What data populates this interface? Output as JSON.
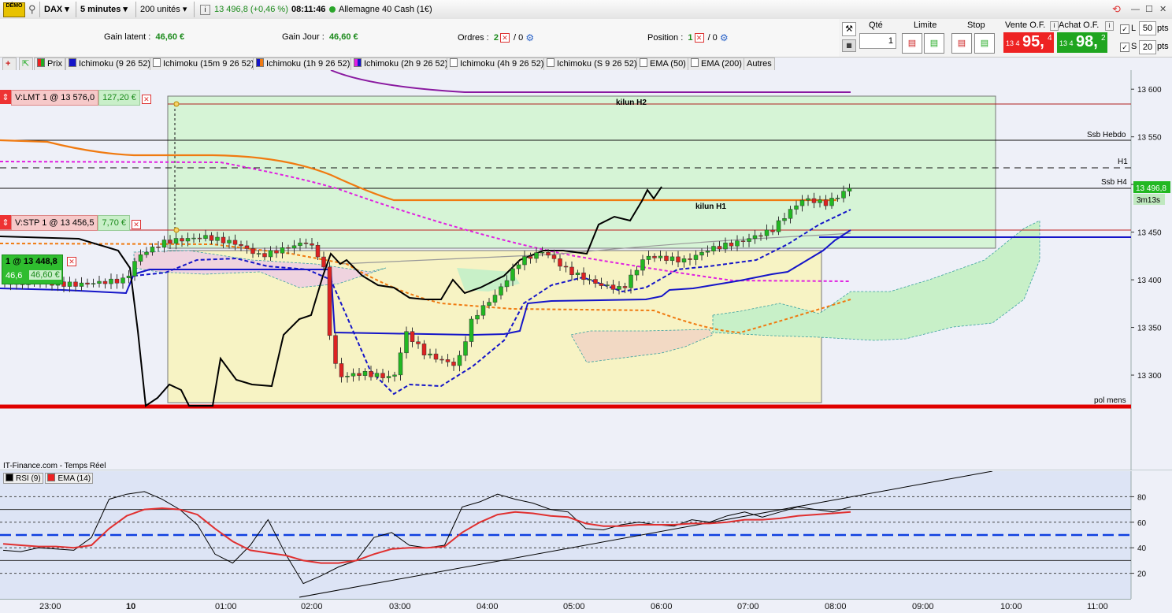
{
  "toolbar": {
    "instrument": "DAX",
    "timeframe": "5 minutes",
    "units": "200 unités",
    "quote": "13 496,8 (+0,46 %)",
    "time": "08:11:46",
    "market": "Allemagne 40 Cash (1€)",
    "demo": "DÉMO"
  },
  "account": {
    "gain_latent_label": "Gain latent :",
    "gain_latent": "46,60 €",
    "gain_jour_label": "Gain Jour :",
    "gain_jour": "46,60 €",
    "ordres_label": "Ordres :",
    "ordres_count": "2",
    "ordres_zero": "/ 0",
    "position_label": "Position :",
    "position_count": "1",
    "position_zero": "/ 0"
  },
  "order_panel": {
    "qty_label": "Qté",
    "qty_value": "1",
    "limit_label": "Limite",
    "stop_label": "Stop",
    "sell_label": "Vente O.F.",
    "sell_prefix": "13 4",
    "sell_big": "95,",
    "sell_small": "4",
    "buy_label": "Achat O.F.",
    "buy_prefix": "13 4",
    "buy_big": "98,",
    "buy_small": "2",
    "l_label": "L",
    "l_value": "50",
    "s_label": "S",
    "s_value": "20",
    "pts": "pts"
  },
  "indicators": [
    "Prix",
    "Ichimoku (9 26 52)",
    "Ichimoku (15m 9 26 52)",
    "Ichimoku (1h 9 26 52)",
    "Ichimoku (2h 9 26 52)",
    "Ichimoku (4h 9 26 52)",
    "Ichimoku (S 9 26 52)",
    "EMA (50)",
    "EMA (200)",
    "Autres"
  ],
  "orders": {
    "lmt_label": "V:LMT  1 @ 13 576,0",
    "lmt_value": "127,20 €",
    "stp_label": "V:STP  1 @ 13 456,5",
    "stp_value": "7,70 €",
    "pos_label": "1 @ 13 448,8",
    "pos_points": "46,6",
    "pos_value": "46,60 €"
  },
  "annotations": {
    "kilun_h2": "kilun H2",
    "kilun_h1": "kilun H1",
    "ssb_hebdo": "Ssb Hebdo",
    "h1": "H1",
    "ssb_h4": "Ssb H4",
    "pol_mens": "pol mens",
    "last_price": "13 496,8",
    "countdown": "3m13s",
    "feed": "IT-Finance.com - Temps Réel"
  },
  "colors": {
    "bull": "#22b822",
    "bear": "#dd2222",
    "kijun": "#1515c8",
    "price_line": "#000000",
    "ema50": "#f07a10",
    "ema200": "#8a1aa0",
    "magenta": "#e020e0",
    "level_red": "#e00000"
  },
  "chart_data": [
    {
      "type": "candlestick",
      "ylim": [
        13200,
        13620
      ],
      "y_ticks": [
        13300,
        13350,
        13400,
        13450,
        13500,
        13550,
        13600
      ],
      "x_ticks": [
        "23:00",
        "10",
        "01:00",
        "02:00",
        "03:00",
        "04:00",
        "05:00",
        "06:00",
        "07:00",
        "08:00",
        "09:00",
        "10:00",
        "11:00"
      ],
      "levels": [
        {
          "name": "kilun H2",
          "value": 13576
        },
        {
          "name": "Ssb Hebdo",
          "value": 13543
        },
        {
          "name": "H1",
          "value": 13517
        },
        {
          "name": "Ssb H4",
          "value": 13495
        },
        {
          "name": "pol mens",
          "value": 13290
        },
        {
          "name": "V:STP",
          "value": 13456.5
        },
        {
          "name": "Position",
          "value": 13448.8
        }
      ],
      "series": [
        {
          "name": "Prix",
          "ohlc_sample": [
            [
              13400,
              13404,
              13394,
              13398
            ],
            [
              13447,
              13452,
              13440,
              13445
            ],
            [
              13410,
              13418,
              13300,
              13310
            ],
            [
              13296,
              13310,
              13288,
              13302
            ],
            [
              13350,
              13372,
              13345,
              13368
            ],
            [
              13432,
              13440,
              13425,
              13436
            ],
            [
              13395,
              13402,
              13385,
              13390
            ],
            [
              13428,
              13440,
              13420,
              13435
            ],
            [
              13455,
              13470,
              13450,
              13468
            ],
            [
              13482,
              13503,
              13478,
              13497
            ]
          ]
        }
      ]
    },
    {
      "type": "line",
      "title": "",
      "ylim": [
        0,
        100
      ],
      "y_ticks": [
        20,
        40,
        60,
        80
      ],
      "series": [
        {
          "name": "RSI (9)",
          "values": [
            38,
            37,
            40,
            39,
            38,
            48,
            78,
            82,
            84,
            78,
            70,
            58,
            35,
            28,
            42,
            62,
            35,
            12,
            18,
            25,
            30,
            48,
            52,
            42,
            40,
            42,
            72,
            76,
            82,
            78,
            75,
            70,
            68,
            55,
            54,
            58,
            60,
            58,
            57,
            62,
            60,
            65,
            68,
            64,
            68,
            72,
            70,
            68,
            72
          ]
        },
        {
          "name": "EMA (14)",
          "values": [
            43,
            42,
            41,
            41,
            40,
            42,
            55,
            65,
            70,
            71,
            70,
            66,
            55,
            45,
            38,
            36,
            34,
            30,
            28,
            28,
            30,
            35,
            39,
            40,
            40,
            41,
            52,
            60,
            66,
            68,
            67,
            65,
            64,
            59,
            57,
            57,
            58,
            58,
            58,
            59,
            59,
            60,
            62,
            62,
            63,
            65,
            66,
            67,
            68
          ]
        }
      ]
    }
  ]
}
